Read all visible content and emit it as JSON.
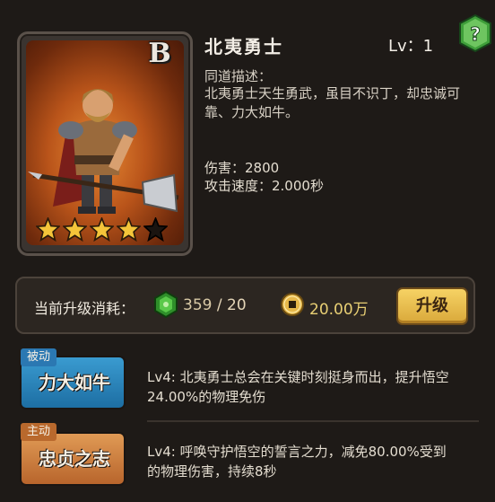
{
  "hero": {
    "name": "北夷勇士",
    "level": "Lv：1",
    "rank": "B",
    "stars_filled": 4,
    "stars_total": 5,
    "desc_label": "同道描述：",
    "desc": "北夷勇士天生勇武，虽目不识丁，却忠诚可靠、力大如牛。",
    "stat_damage": "伤害：2800",
    "stat_speed": "攻击速度：2.000秒"
  },
  "upgrade": {
    "label": "当前升级消耗：",
    "gem_have": "359",
    "gem_sep": " / ",
    "gem_need": "20",
    "coin_cost": "20.00万",
    "button_label": "升级"
  },
  "skills": [
    {
      "type": "被动",
      "name": "力大如牛",
      "desc": "Lv4:  北夷勇士总会在关键时刻挺身而出，提升悟空24.00%的物理免伤"
    },
    {
      "type": "主动",
      "name": "忠贞之志",
      "desc": "Lv4:  呼唤守护悟空的誓言之力，减免80.00%受到的物理伤害，持续8秒"
    }
  ],
  "help": {
    "icon": "question-hex-icon",
    "label": "?"
  },
  "colors": {
    "background": "#1e1a17",
    "gem": "#3fae3a",
    "coin": "#e8cf74",
    "button": "#f0c24f",
    "passive": "#2b78b2",
    "active": "#b9692d"
  }
}
